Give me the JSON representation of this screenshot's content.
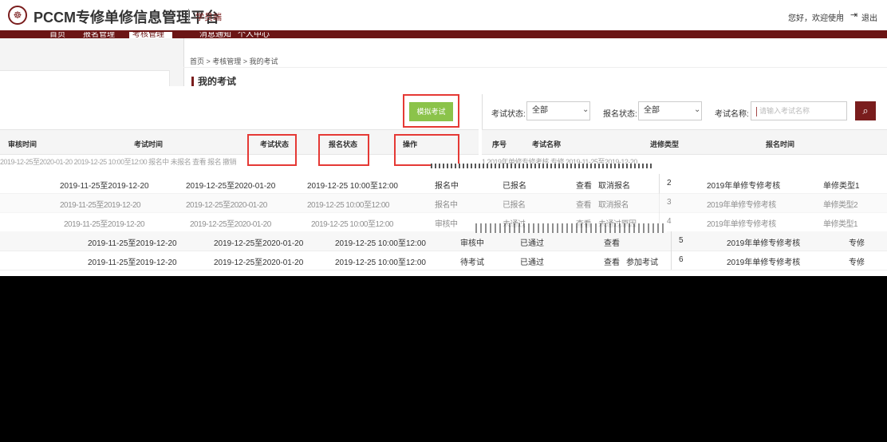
{
  "header": {
    "logo_glyph": "☸",
    "title": "PCCM专修单修信息管理平台",
    "role": "学员端",
    "greeting": "您好，欢迎使用",
    "logout": "退出"
  },
  "nav": {
    "items": [
      "首页",
      "报名管理",
      "考核管理",
      "消息通知",
      "个人中心"
    ],
    "active_index": 2
  },
  "breadcrumb": "首页 > 考核管理 > 我的考试",
  "section_title": "我的考试",
  "mock_exam_button": "模拟考试",
  "left_table": {
    "headers": [
      "审核时间",
      "考试时间",
      "考试状态",
      "报名状态",
      "操作"
    ],
    "partial_row": "2019-12-25至2020-01-20    2019-12-25 10:00至12:00    报名中    未报名    查看  报名  撤销"
  },
  "filters": {
    "exam_status_label": "考试状态:",
    "exam_status_value": "全部",
    "signup_status_label": "报名状态:",
    "signup_status_value": "全部",
    "exam_name_label": "考试名称:",
    "exam_name_placeholder": "请输入考试名称"
  },
  "right_table": {
    "headers": [
      "序号",
      "考试名称",
      "进修类型",
      "报名时间"
    ],
    "partial_row": "1    2019年单修专修考核    专修    2019-11-25至2019-12-20"
  },
  "lower_rows": [
    {
      "signup": "2019-11-25至2019-12-20",
      "review": "2019-12-25至2020-01-20",
      "exam": "2019-12-25 10:00至12:00",
      "exam_status": "报名中",
      "signup_status": "已报名",
      "actions": [
        "查看",
        "取消报名"
      ],
      "no": "2",
      "name": "2019年单修专修考核",
      "type": "单修类型1",
      "glitch": false
    },
    {
      "signup": "2019-11-25至2019-12-20",
      "review": "2019-12-25至2020-01-20",
      "exam": "2019-12-25 10:00至12:00",
      "exam_status": "报名中",
      "signup_status": "已报名",
      "actions": [
        "查看",
        "取消报名"
      ],
      "no": "3",
      "name": "2019年单修专修考核",
      "type": "单修类型2",
      "glitch": true
    },
    {
      "signup": "2019-11-25至2019-12-20",
      "review": "2019-12-25至2020-01-20",
      "exam": "2019-12-25 10:00至12:00",
      "exam_status": "审核中",
      "signup_status": "未通过",
      "actions": [
        "查看",
        "未通过原因"
      ],
      "no": "4",
      "name": "2019年单修专修考核",
      "type": "单修类型1",
      "glitch": true
    },
    {
      "signup": "2019-11-25至2019-12-20",
      "review": "2019-12-25至2020-01-20",
      "exam": "2019-12-25 10:00至12:00",
      "exam_status": "审核中",
      "signup_status": "已通过",
      "actions": [
        "查看"
      ],
      "no": "5",
      "name": "2019年单修专修考核",
      "type": "专修",
      "glitch": false
    },
    {
      "signup": "2019-11-25至2019-12-20",
      "review": "2019-12-25至2020-01-20",
      "exam": "2019-12-25 10:00至12:00",
      "exam_status": "待考试",
      "signup_status": "已通过",
      "actions": [
        "查看",
        "参加考试"
      ],
      "no": "6",
      "name": "2019年单修专修考核",
      "type": "专修",
      "glitch": false
    }
  ],
  "colors": {
    "brand": "#7a1d1d",
    "nav_bg": "#6b1515",
    "highlight": "#e53935",
    "mock_btn": "#8bc34a"
  }
}
